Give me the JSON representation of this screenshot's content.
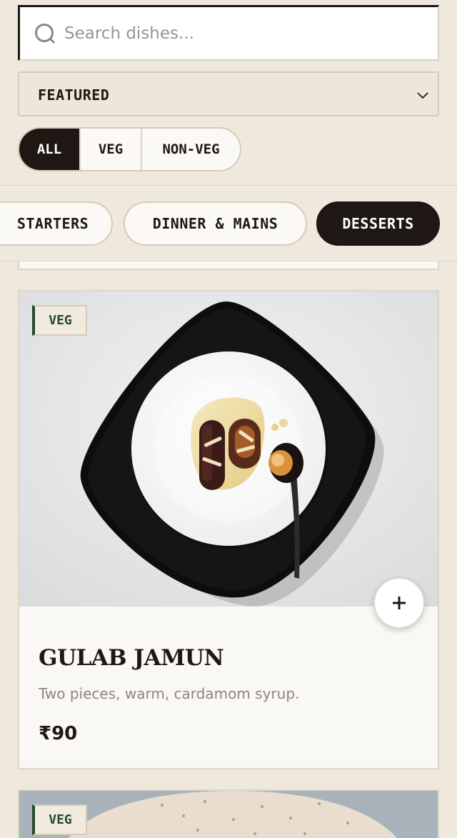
{
  "search": {
    "placeholder": "Search dishes..."
  },
  "sort": {
    "selected": "FEATURED"
  },
  "diet_filter": {
    "options": [
      "ALL",
      "VEG",
      "NON-VEG"
    ],
    "active": "ALL"
  },
  "categories": {
    "items": [
      "STARTERS",
      "DINNER & MAINS",
      "DESSERTS"
    ],
    "active": "DESSERTS"
  },
  "dishes": [
    {
      "tag": "VEG",
      "name": "GULAB JAMUN",
      "description": "Two pieces, warm, cardamom syrup.",
      "price": "₹90",
      "add_label": "+"
    },
    {
      "tag": "VEG"
    }
  ],
  "colors": {
    "dark": "#1e1714",
    "background": "#eee8dd",
    "card": "#faf8f4",
    "veg_accent": "#244a33"
  }
}
